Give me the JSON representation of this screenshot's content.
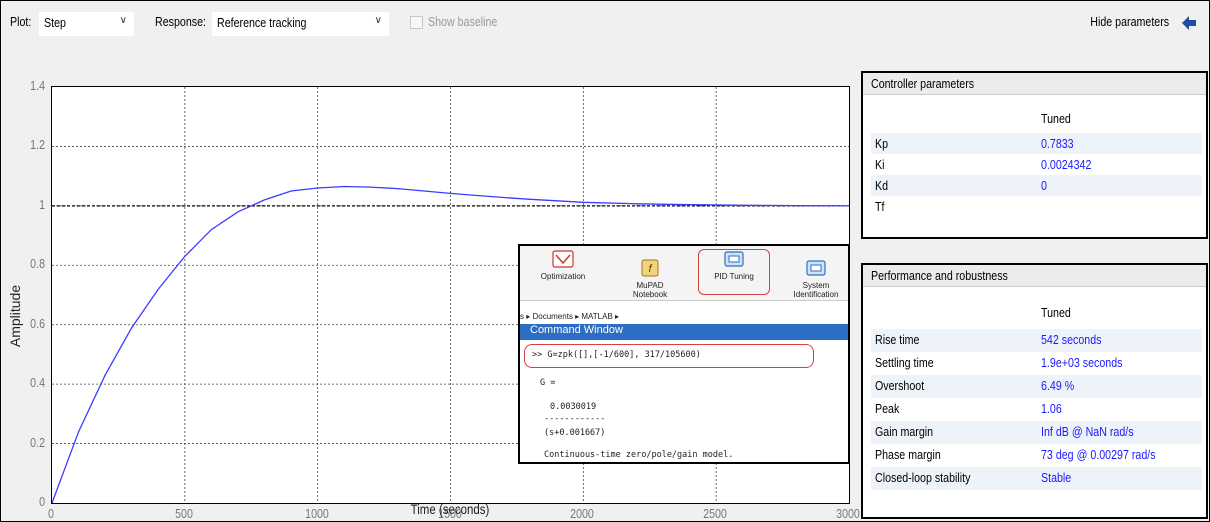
{
  "toolbar": {
    "plot_label": "Plot:",
    "plot_value": "Step",
    "response_label": "Response:",
    "response_value": "Reference tracking",
    "baseline_label": "Show baseline",
    "baseline_checked": false,
    "hide_params_label": "Hide parameters",
    "hide_params_icon": "arrow-left-icon"
  },
  "chart_data": {
    "type": "line",
    "title": "",
    "xlabel": "Time (seconds)",
    "ylabel": "Amplitude",
    "xlim": [
      0,
      3000
    ],
    "ylim": [
      0,
      1.4
    ],
    "x_ticks": [
      "0",
      "500",
      "1000",
      "1500",
      "2000",
      "2500",
      "3000"
    ],
    "y_ticks": [
      "0",
      "0.2",
      "0.4",
      "0.6",
      "0.8",
      "1",
      "1.2",
      "1.4"
    ],
    "grid": true,
    "series": [
      {
        "color": "#3b3bff",
        "x": [
          0,
          100,
          200,
          300,
          400,
          500,
          600,
          700,
          800,
          900,
          1000,
          1100,
          1200,
          1300,
          1400,
          1500,
          1600,
          1700,
          1800,
          1900,
          2000,
          2200,
          2400,
          2600,
          2800,
          3000
        ],
        "y": [
          0,
          0.24,
          0.43,
          0.59,
          0.72,
          0.83,
          0.92,
          0.98,
          1.02,
          1.05,
          1.06,
          1.065,
          1.063,
          1.058,
          1.05,
          1.042,
          1.035,
          1.028,
          1.022,
          1.017,
          1.012,
          1.007,
          1.004,
          1.002,
          1.001,
          1.0
        ]
      }
    ]
  },
  "inset": {
    "ribbon": [
      {
        "label": "Optimization",
        "icon": "optimization-icon"
      },
      {
        "label": "MuPAD\nNotebook",
        "icon": "mupad-icon"
      },
      {
        "label": "PID Tuning",
        "icon": "pid-tuning-icon"
      },
      {
        "label": "System\nIdentification",
        "icon": "system-identification-icon"
      }
    ],
    "breadcrumb": "s ▸ Documents ▸ MATLAB ▸",
    "command_window_title": "Command Window",
    "lines": [
      ">> G=zpk([],[-1/600], 317/105600)",
      "G =",
      "0.0030019",
      "------------",
      "(s+0.001667)",
      "Continuous-time zero/pole/gain model."
    ]
  },
  "controller": {
    "title": "Controller parameters",
    "column": "Tuned",
    "rows": [
      {
        "name": "Kp",
        "value": "0.7833"
      },
      {
        "name": "Ki",
        "value": "0.0024342"
      },
      {
        "name": "Kd",
        "value": "0"
      },
      {
        "name": "Tf",
        "value": ""
      }
    ]
  },
  "performance": {
    "title": "Performance and robustness",
    "column": "Tuned",
    "rows": [
      {
        "name": "Rise time",
        "value": "542 seconds"
      },
      {
        "name": "Settling time",
        "value": "1.9e+03 seconds"
      },
      {
        "name": "Overshoot",
        "value": "6.49 %"
      },
      {
        "name": "Peak",
        "value": "1.06"
      },
      {
        "name": "Gain margin",
        "value": "Inf dB @ NaN rad/s"
      },
      {
        "name": "Phase margin",
        "value": "73 deg @ 0.00297 rad/s"
      },
      {
        "name": "Closed-loop stability",
        "value": "Stable"
      }
    ]
  }
}
